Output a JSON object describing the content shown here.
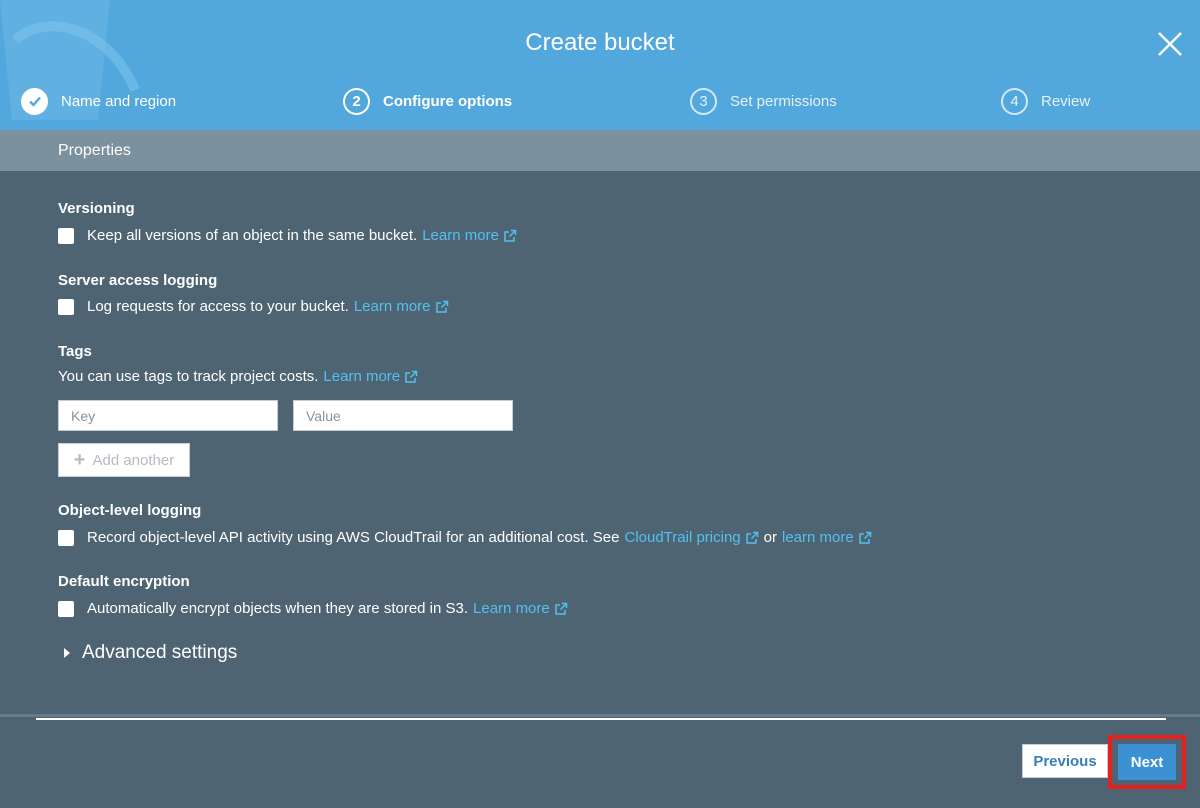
{
  "header": {
    "title": "Create bucket",
    "steps": [
      {
        "number": "",
        "label": "Name and region",
        "state": "done"
      },
      {
        "number": "2",
        "label": "Configure options",
        "state": "current"
      },
      {
        "number": "3",
        "label": "Set permissions",
        "state": "inactive"
      },
      {
        "number": "4",
        "label": "Review",
        "state": "inactive"
      }
    ]
  },
  "properties_title": "Properties",
  "sections": {
    "versioning": {
      "title": "Versioning",
      "text": "Keep all versions of an object in the same bucket.",
      "link": "Learn more"
    },
    "access_logging": {
      "title": "Server access logging",
      "text": "Log requests for access to your bucket.",
      "link": "Learn more"
    },
    "tags": {
      "title": "Tags",
      "text": "You can use tags to track project costs.",
      "link": "Learn more",
      "key_placeholder": "Key",
      "value_placeholder": "Value",
      "add_label": "Add another"
    },
    "object_logging": {
      "title": "Object-level logging",
      "text": "Record object-level API activity using AWS CloudTrail for an additional cost. See",
      "link1": "CloudTrail pricing",
      "or_text": "or",
      "link2": "learn more"
    },
    "encryption": {
      "title": "Default encryption",
      "text": "Automatically encrypt objects when they are stored in S3.",
      "link": "Learn more"
    }
  },
  "advanced_label": "Advanced settings",
  "footer": {
    "previous_label": "Previous",
    "next_label": "Next"
  },
  "colors": {
    "header": "#52a7dc",
    "panel": "#4e6473",
    "link": "#52c0f0",
    "primary": "#3b91d1",
    "highlight": "#e8201b"
  }
}
